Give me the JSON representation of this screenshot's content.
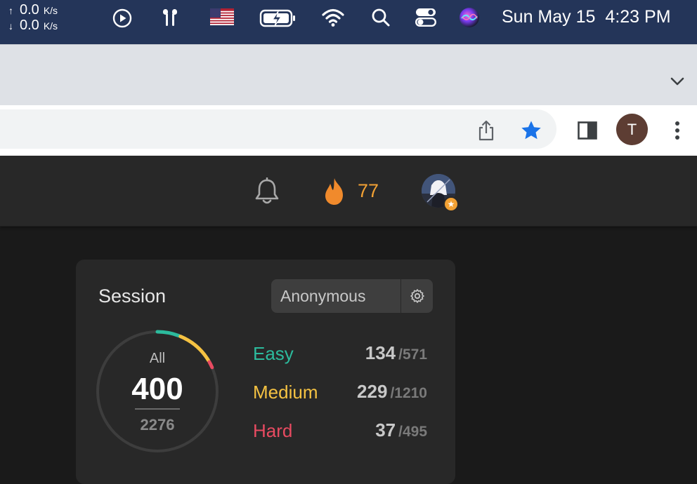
{
  "menubar": {
    "net_up": "0.0",
    "net_down": "0.0",
    "net_unit": "K/s",
    "date": "Sun May 15",
    "time": "4:23 PM",
    "icons": [
      "play-icon",
      "airpods-icon",
      "us-flag-icon",
      "battery-charging-icon",
      "wifi-icon",
      "search-icon",
      "control-center-icon",
      "siri-icon"
    ]
  },
  "browser": {
    "profile_initial": "T",
    "icons": [
      "chevron-down-icon",
      "share-icon",
      "bookmark-star-icon",
      "side-panel-icon",
      "more-icon"
    ],
    "star_color": "#1a73e8"
  },
  "appnav": {
    "streak_count": "77",
    "accent": "#f2a134",
    "icons": [
      "bell-icon",
      "fire-icon",
      "premium-star-icon"
    ]
  },
  "session": {
    "title": "Session",
    "selected": "Anonymous",
    "ring": {
      "label": "All",
      "solved": "400",
      "total": "2276"
    },
    "difficulties": [
      {
        "name": "Easy",
        "solved": "134",
        "total": "/571",
        "color": "#2cbb9d"
      },
      {
        "name": "Medium",
        "solved": "229",
        "total": "/1210",
        "color": "#f5c242"
      },
      {
        "name": "Hard",
        "solved": "37",
        "total": "/495",
        "color": "#e84b61"
      }
    ]
  }
}
